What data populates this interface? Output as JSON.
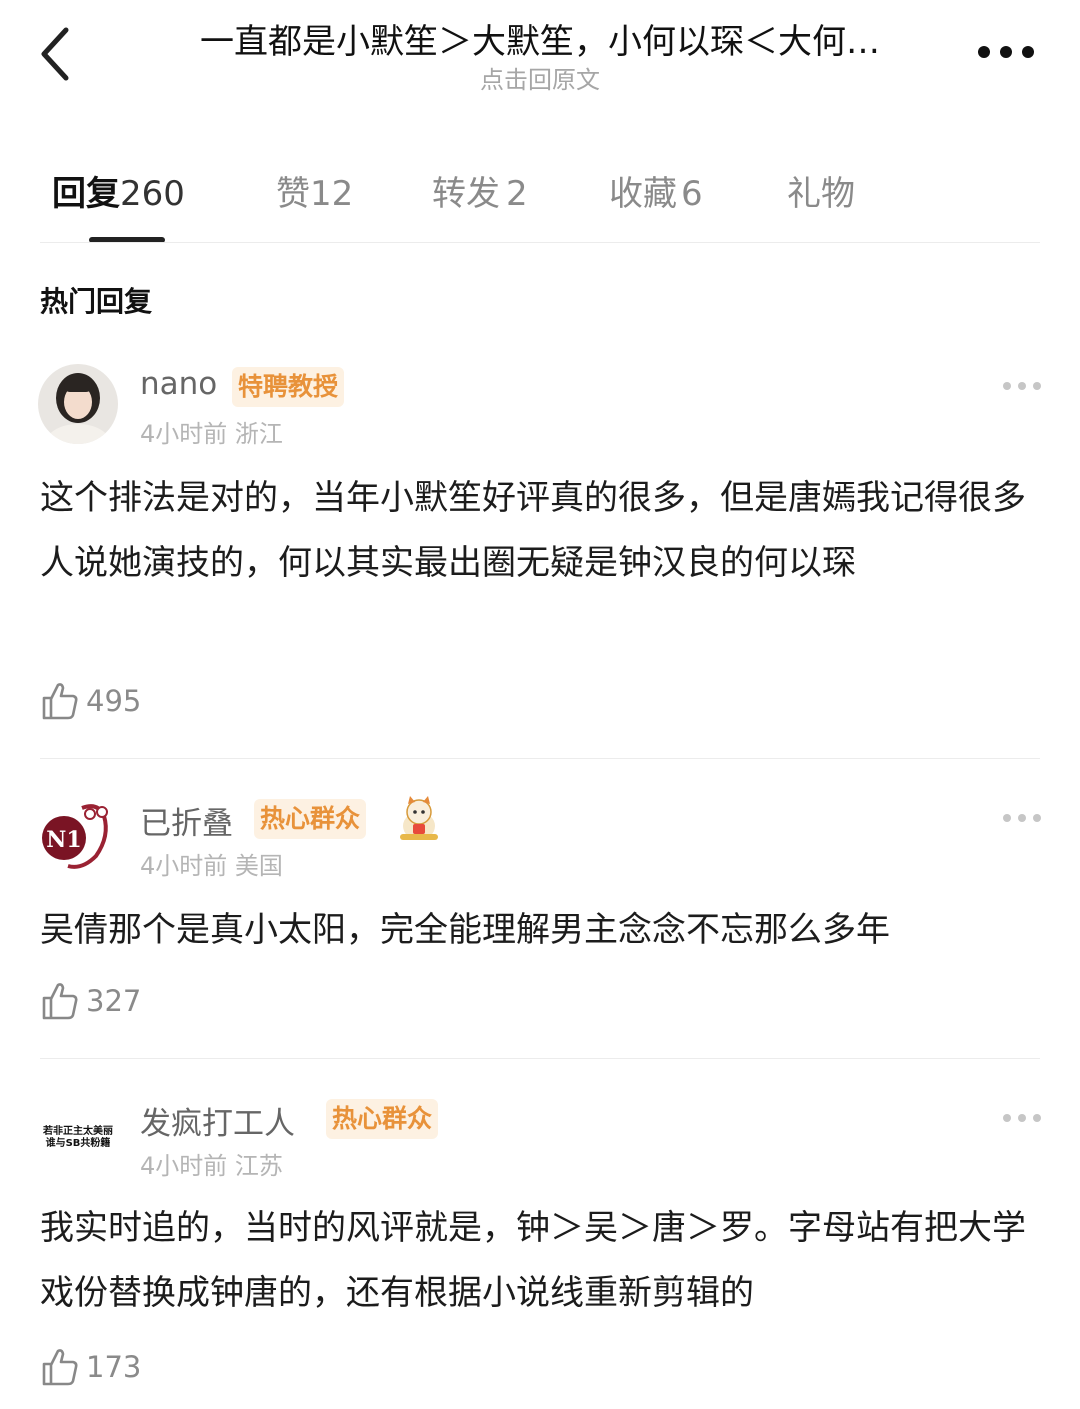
{
  "header": {
    "title": "一直都是小默笙＞大默笙，小何以琛＜大何…",
    "subtitle": "点击回原文",
    "back_icon": "chevron-left-icon",
    "more_icon": "more-dots-icon"
  },
  "tabs": [
    {
      "label": "回复",
      "count": "260"
    },
    {
      "label": "赞",
      "count": "12"
    },
    {
      "label": "转发",
      "count": "2"
    },
    {
      "label": "收藏",
      "count": "6"
    },
    {
      "label": "礼物",
      "count": ""
    }
  ],
  "section_title": "热门回复",
  "comments": [
    {
      "username": "nano",
      "badge": "特聘教授",
      "time": "4小时前",
      "location": "浙江",
      "text": "这个排法是对的，当年小默笙好评真的很多，但是唐嫣我记得很多人说她演技的，何以其实最出圈无疑是钟汉良的何以琛",
      "likes": "495"
    },
    {
      "username": "已折叠",
      "badge": "热心群众",
      "time": "4小时前",
      "location": "美国",
      "avatar_text": "N1",
      "text": "吴倩那个是真小太阳，完全能理解男主念念不忘那么多年",
      "likes": "327"
    },
    {
      "username": "发疯打工人",
      "badge": "热心群众",
      "time": "4小时前",
      "location": "江苏",
      "avatar_text": "若非正主太美丽 谁与SB共粉籍",
      "text": "我实时追的，当时的风评就是，钟＞吴＞唐＞罗。字母站有把大学戏份替换成钟唐的，还有根据小说线重新剪辑的",
      "likes": "173"
    }
  ],
  "colors": {
    "badge_bg": "#fdf1e2",
    "badge_text": "#e8923a",
    "muted": "#8a8a8a"
  }
}
